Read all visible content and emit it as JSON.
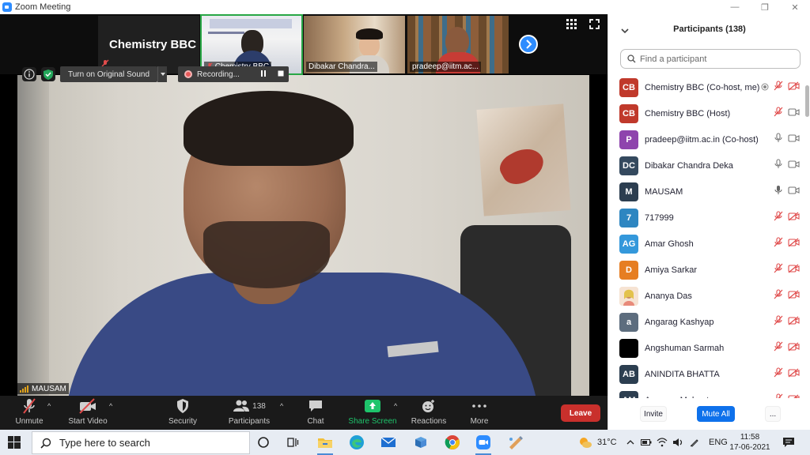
{
  "window": {
    "title": "Zoom Meeting"
  },
  "thumbnails": [
    {
      "name": "Chemistry BBC",
      "big_name": "Chemistry BBC"
    },
    {
      "name": "Chemistry BBC"
    },
    {
      "name": "Dibakar Chandra..."
    },
    {
      "name": "pradeep@iitm.ac..."
    }
  ],
  "video_toolbar": {
    "original_sound_label": "Turn on Original Sound",
    "recording_label": "Recording..."
  },
  "speaker": {
    "name": "MAUSAM"
  },
  "toolbar": {
    "unmute": "Unmute",
    "start_video": "Start Video",
    "security": "Security",
    "participants": "Participants",
    "participant_count": "138",
    "chat": "Chat",
    "share_screen": "Share Screen",
    "reactions": "Reactions",
    "more": "More",
    "leave": "Leave"
  },
  "panel": {
    "title": "Participants (138)",
    "search_placeholder": "Find a participant",
    "participants": [
      {
        "initials": "CB",
        "name": "Chemistry BBC (Co-host, me)",
        "color": "#c0392b",
        "mic": "muted",
        "video": "off",
        "extra": "recording"
      },
      {
        "initials": "CB",
        "name": "Chemistry BBC (Host)",
        "color": "#c0392b",
        "mic": "muted",
        "video": "on"
      },
      {
        "initials": "P",
        "name": "pradeep@iitm.ac.in (Co-host)",
        "color": "#8e44ad",
        "mic": "on",
        "video": "on"
      },
      {
        "initials": "DC",
        "name": "Dibakar Chandra Deka",
        "color": "#34495e",
        "mic": "on",
        "video": "on"
      },
      {
        "initials": "M",
        "name": "MAUSAM",
        "color": "#2c3e50",
        "mic": "active",
        "video": "on"
      },
      {
        "initials": "7",
        "name": "717999",
        "color": "#2e86c1",
        "mic": "muted",
        "video": "off"
      },
      {
        "initials": "AG",
        "name": "Amar Ghosh",
        "color": "#3498db",
        "mic": "muted",
        "video": "off"
      },
      {
        "initials": "D",
        "name": "Amiya Sarkar",
        "color": "#e67e22",
        "mic": "muted",
        "video": "off"
      },
      {
        "initials": "",
        "name": "Ananya Das",
        "color": "#f3d9c6",
        "mic": "muted",
        "video": "off",
        "photo": true
      },
      {
        "initials": "a",
        "name": "Angarag Kashyap",
        "color": "#5d6d7e",
        "mic": "muted",
        "video": "off"
      },
      {
        "initials": "",
        "name": "Angshuman Sarmah",
        "color": "#000000",
        "mic": "muted",
        "video": "off"
      },
      {
        "initials": "AB",
        "name": "ANINDITA BHATTA",
        "color": "#2c3e50",
        "mic": "muted",
        "video": "off"
      },
      {
        "initials": "AM",
        "name": "Anuraag Mahanta",
        "color": "#2c3e50",
        "mic": "muted",
        "video": "off"
      }
    ],
    "invite": "Invite",
    "mute_all": "Mute All",
    "more": "..."
  },
  "taskbar": {
    "search_placeholder": "Type here to search",
    "temperature": "31°C",
    "language": "ENG",
    "time": "11:58",
    "date": "17-06-2021"
  },
  "colors": {
    "zoom_blue": "#2d8cff",
    "leave_red": "#c9302c",
    "share_green": "#1ec46b",
    "mute_all_blue": "#0e71eb"
  }
}
